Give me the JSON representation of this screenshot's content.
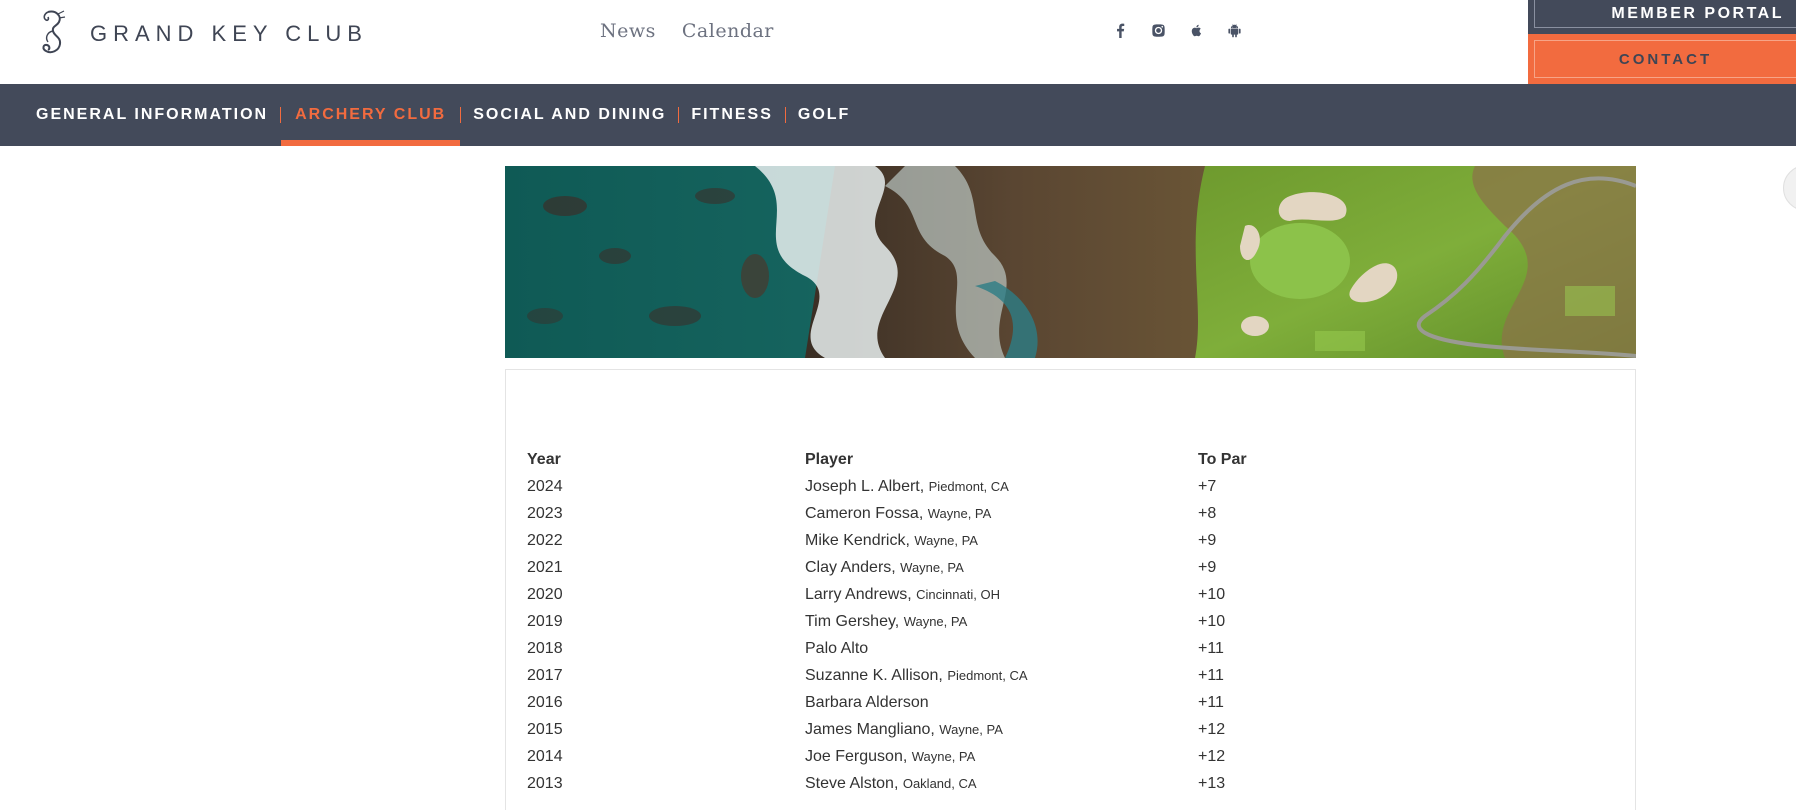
{
  "brand": {
    "name": "GRAND KEY CLUB"
  },
  "top_links": [
    {
      "label": "News"
    },
    {
      "label": "Calendar"
    }
  ],
  "social": [
    "facebook-icon",
    "instagram-icon",
    "apple-icon",
    "android-icon"
  ],
  "member_portal_label": "MEMBER PORTAL",
  "contact_label": "CONTACT",
  "nav": [
    {
      "label": "GENERAL INFORMATION",
      "active": false
    },
    {
      "label": "ARCHERY CLUB",
      "active": true
    },
    {
      "label": "SOCIAL AND DINING",
      "active": false
    },
    {
      "label": "FITNESS",
      "active": false
    },
    {
      "label": "GOLF",
      "active": false
    }
  ],
  "colors": {
    "accent": "#f26b3f",
    "nav_bg": "#434a5a"
  },
  "table": {
    "headers": {
      "year": "Year",
      "player": "Player",
      "to_par": "To Par"
    },
    "rows": [
      {
        "year": "2024",
        "player": "Joseph L. Albert",
        "location": "Piedmont, CA",
        "to_par": "+7"
      },
      {
        "year": "2023",
        "player": "Cameron Fossa",
        "location": "Wayne, PA",
        "to_par": "+8"
      },
      {
        "year": "2022",
        "player": "Mike Kendrick",
        "location": "Wayne, PA",
        "to_par": "+9"
      },
      {
        "year": "2021",
        "player": "Clay Anders",
        "location": "Wayne, PA",
        "to_par": "+9"
      },
      {
        "year": "2020",
        "player": "Larry Andrews",
        "location": "Cincinnati, OH",
        "to_par": "+10"
      },
      {
        "year": "2019",
        "player": "Tim Gershey",
        "location": "Wayne, PA",
        "to_par": "+10"
      },
      {
        "year": "2018",
        "player": "Palo Alto",
        "location": "",
        "to_par": "+11"
      },
      {
        "year": "2017",
        "player": "Suzanne K. Allison",
        "location": "Piedmont, CA",
        "to_par": "+11"
      },
      {
        "year": "2016",
        "player": "Barbara Alderson",
        "location": "",
        "to_par": "+11"
      },
      {
        "year": "2015",
        "player": "James Mangliano",
        "location": "Wayne, PA",
        "to_par": "+12"
      },
      {
        "year": "2014",
        "player": "Joe Ferguson",
        "location": "Wayne, PA",
        "to_par": "+12"
      },
      {
        "year": "2013",
        "player": "Steve Alston",
        "location": "Oakland, CA",
        "to_par": "+13"
      }
    ]
  }
}
